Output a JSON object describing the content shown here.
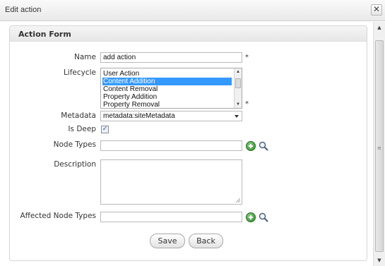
{
  "dialog": {
    "title": "Edit action",
    "close_glyph": "✕"
  },
  "form": {
    "header": "Action Form",
    "name": {
      "label": "Name",
      "value": "add action",
      "required_mark": "*"
    },
    "lifecycle": {
      "label": "Lifecycle",
      "options": [
        "User Action",
        "Content Addition",
        "Content Removal",
        "Property Addition",
        "Property Removal"
      ],
      "selected": "Content Addition",
      "required_mark": "*"
    },
    "metadata": {
      "label": "Metadata",
      "value": "metadata:siteMetadata"
    },
    "is_deep": {
      "label": "Is Deep",
      "checked": true
    },
    "node_types": {
      "label": "Node Types",
      "value": ""
    },
    "description": {
      "label": "Description",
      "value": ""
    },
    "affected_node_types": {
      "label": "Affected Node Types",
      "value": ""
    },
    "buttons": {
      "save": "Save",
      "back": "Back"
    }
  },
  "colors": {
    "selection": "#3399ff",
    "add_icon": "#2f8a2a"
  },
  "icons": [
    "close-icon",
    "add-icon",
    "search-icon"
  ]
}
